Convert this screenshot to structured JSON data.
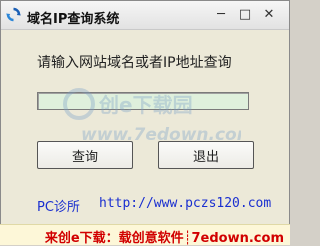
{
  "window": {
    "title": "域名IP查询系统",
    "icon": "refresh-arrows-icon",
    "controls": {
      "minimize": "─",
      "maximize": "□",
      "close": "✕"
    }
  },
  "main": {
    "prompt": "请输入网站域名或者IP地址查询",
    "input_value": "",
    "query_button": "查询",
    "exit_button": "退出"
  },
  "footer": {
    "label": "PC诊所",
    "url": "http://www.pczs120.com"
  },
  "watermark": {
    "brand": "创e下载园",
    "site": "www.7edown.com"
  },
  "banner": {
    "text": "来创e下载：载创意软件┊7edown.com"
  },
  "colors": {
    "input_bg": "#dff0dc",
    "link": "#1a2fd0",
    "banner_text": "#d10000"
  }
}
